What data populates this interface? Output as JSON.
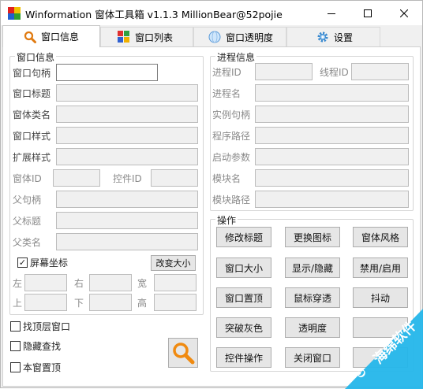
{
  "window": {
    "title": "Winformation 窗体工具箱 v1.1.3  MillionBear@52pojie",
    "icons": [
      "app-icon",
      "minimize-icon",
      "maximize-icon",
      "close-icon"
    ]
  },
  "tabs": [
    {
      "label": "窗口信息",
      "icon": "magnifier-icon",
      "active": true
    },
    {
      "label": "窗口列表",
      "icon": "tiles-icon",
      "active": false
    },
    {
      "label": "窗口透明度",
      "icon": "globe-icon",
      "active": false
    },
    {
      "label": "设置",
      "icon": "gear-icon",
      "active": false
    }
  ],
  "window_info": {
    "group_title": "窗口信息",
    "handle_label": "窗口句柄",
    "title_label": "窗口标题",
    "class_label": "窗体类名",
    "style_label": "窗口样式",
    "exstyle_label": "扩展样式",
    "window_id_label": "窗体ID",
    "control_id_label": "控件ID",
    "parent_handle_label": "父句柄",
    "parent_title_label": "父标题",
    "parent_class_label": "父类名",
    "screen_coords_label": "屏幕坐标",
    "screen_coords_checked": true,
    "resize_button": "改变大小",
    "left_label": "左",
    "right_label": "右",
    "width_label": "宽",
    "top_label": "上",
    "bottom_label": "下",
    "height_label": "高"
  },
  "process_info": {
    "group_title": "进程信息",
    "process_id_label": "进程ID",
    "thread_id_label": "线程ID",
    "process_name_label": "进程名",
    "instance_handle_label": "实例句柄",
    "program_path_label": "程序路径",
    "launch_args_label": "启动参数",
    "module_name_label": "模块名",
    "module_path_label": "模块路径"
  },
  "operations": {
    "group_title": "操作",
    "buttons": [
      "修改标题",
      "更换图标",
      "窗体风格",
      "窗口大小",
      "显示/隐藏",
      "禁用/启用",
      "窗口置顶",
      "鼠标穿透",
      "抖动",
      "突破灰色",
      "透明度",
      "",
      "控件操作",
      "关闭窗口",
      ""
    ]
  },
  "options": [
    {
      "label": "找顶层窗口",
      "checked": false
    },
    {
      "label": "隐藏查找",
      "checked": false
    },
    {
      "label": "本窗置顶",
      "checked": false
    }
  ],
  "search_button_icon": "search-icon",
  "watermark": {
    "text": "海绵软件",
    "icon": "sponge-logo-icon"
  }
}
